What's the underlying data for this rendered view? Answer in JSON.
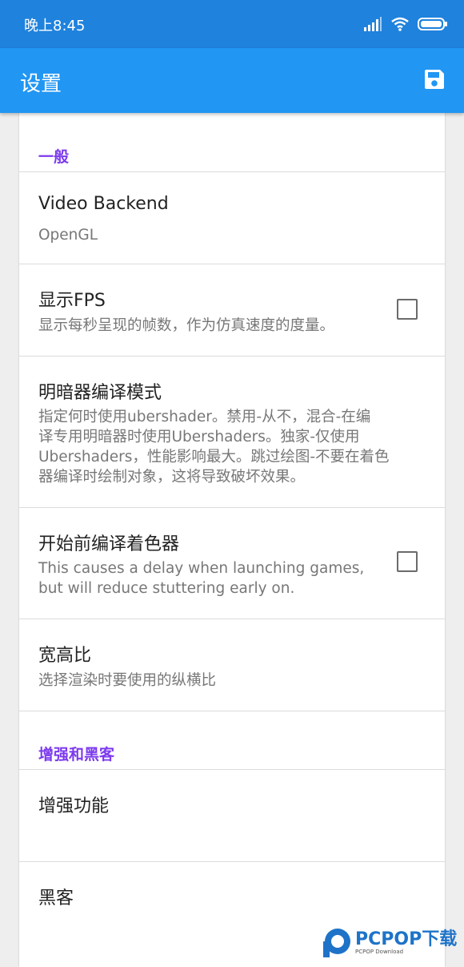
{
  "status_bar": {
    "time": "晚上8:45"
  },
  "app_bar": {
    "title": "设置",
    "save_icon": "save-icon"
  },
  "sections": {
    "general": {
      "header": "一般",
      "video_backend": {
        "title": "Video Backend",
        "summary": "OpenGL"
      },
      "show_fps": {
        "title": "显示FPS",
        "summary": "显示每秒呈现的帧数，作为仿真速度的度量。",
        "checked": false
      },
      "shader_mode": {
        "title": "明暗器编译模式",
        "summary_lines": [
          "指定何时使用ubershader。禁用-从不，混合-在编",
          "译专用明暗器时使用Ubershaders。独家-仅使用",
          "Ubershaders，性能影响最大。跳过绘图-不要在着色",
          "器编译时绘制对象，这将导致破坏效果。"
        ]
      },
      "precompile": {
        "title": "开始前编译着色器",
        "summary_lines": [
          "This causes a delay when launching games,",
          "but will reduce stuttering early on."
        ],
        "checked": false
      },
      "aspect_ratio": {
        "title": "宽高比",
        "summary": "选择渲染时要使用的纵横比"
      }
    },
    "enhancements_hacks": {
      "header": "增强和黑客",
      "enhancements": {
        "title": "增强功能"
      },
      "hacks": {
        "title": "黑客"
      }
    }
  },
  "watermark": {
    "text": "PCPOP下载",
    "sub": "PCPOP Download"
  },
  "colors": {
    "status_bar": "#1f82dd",
    "app_bar": "#2196f3",
    "section_header": "#7c3aed"
  }
}
